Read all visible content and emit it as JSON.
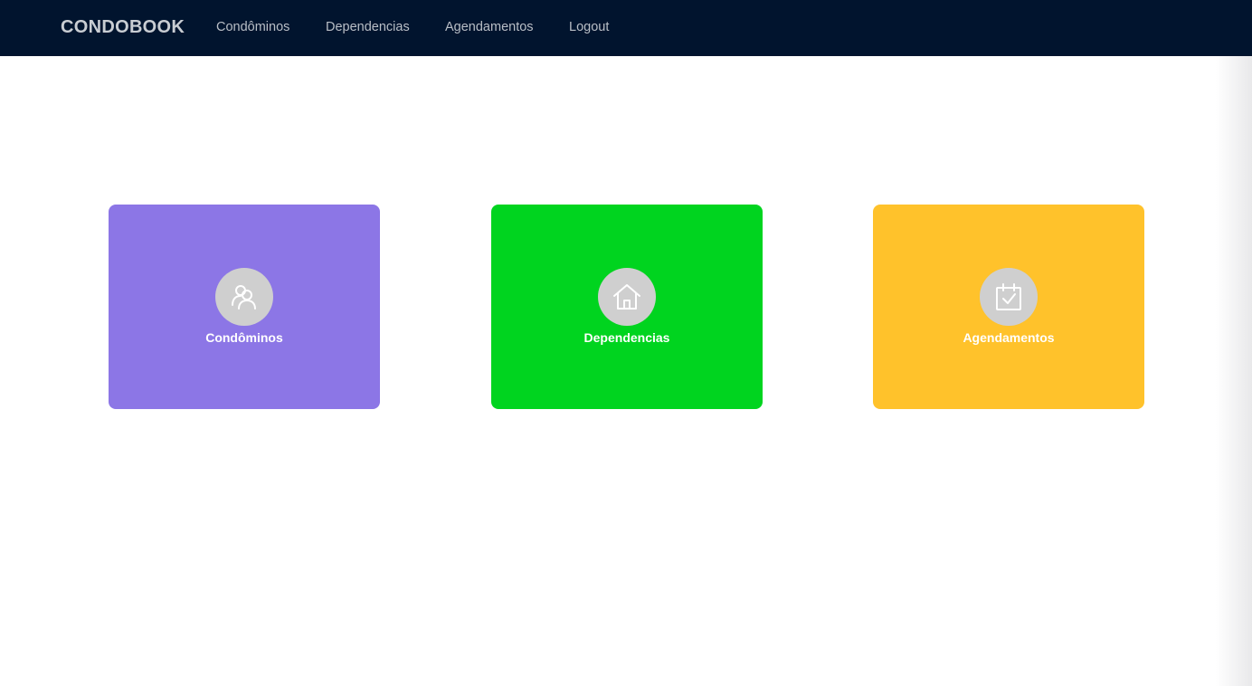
{
  "navbar": {
    "brand": "CONDOBOOK",
    "links": [
      {
        "label": "Condôminos"
      },
      {
        "label": "Dependencias"
      },
      {
        "label": "Agendamentos"
      },
      {
        "label": "Logout"
      }
    ]
  },
  "cards": [
    {
      "label": "Condôminos",
      "icon": "users-icon",
      "color": "#8c76e6"
    },
    {
      "label": "Dependencias",
      "icon": "home-icon",
      "color": "#00d41f"
    },
    {
      "label": "Agendamentos",
      "icon": "calendar-check-icon",
      "color": "#ffc22b"
    }
  ],
  "colors": {
    "navbar_bg": "#01142e",
    "icon_circle": "#cfcfcf"
  }
}
